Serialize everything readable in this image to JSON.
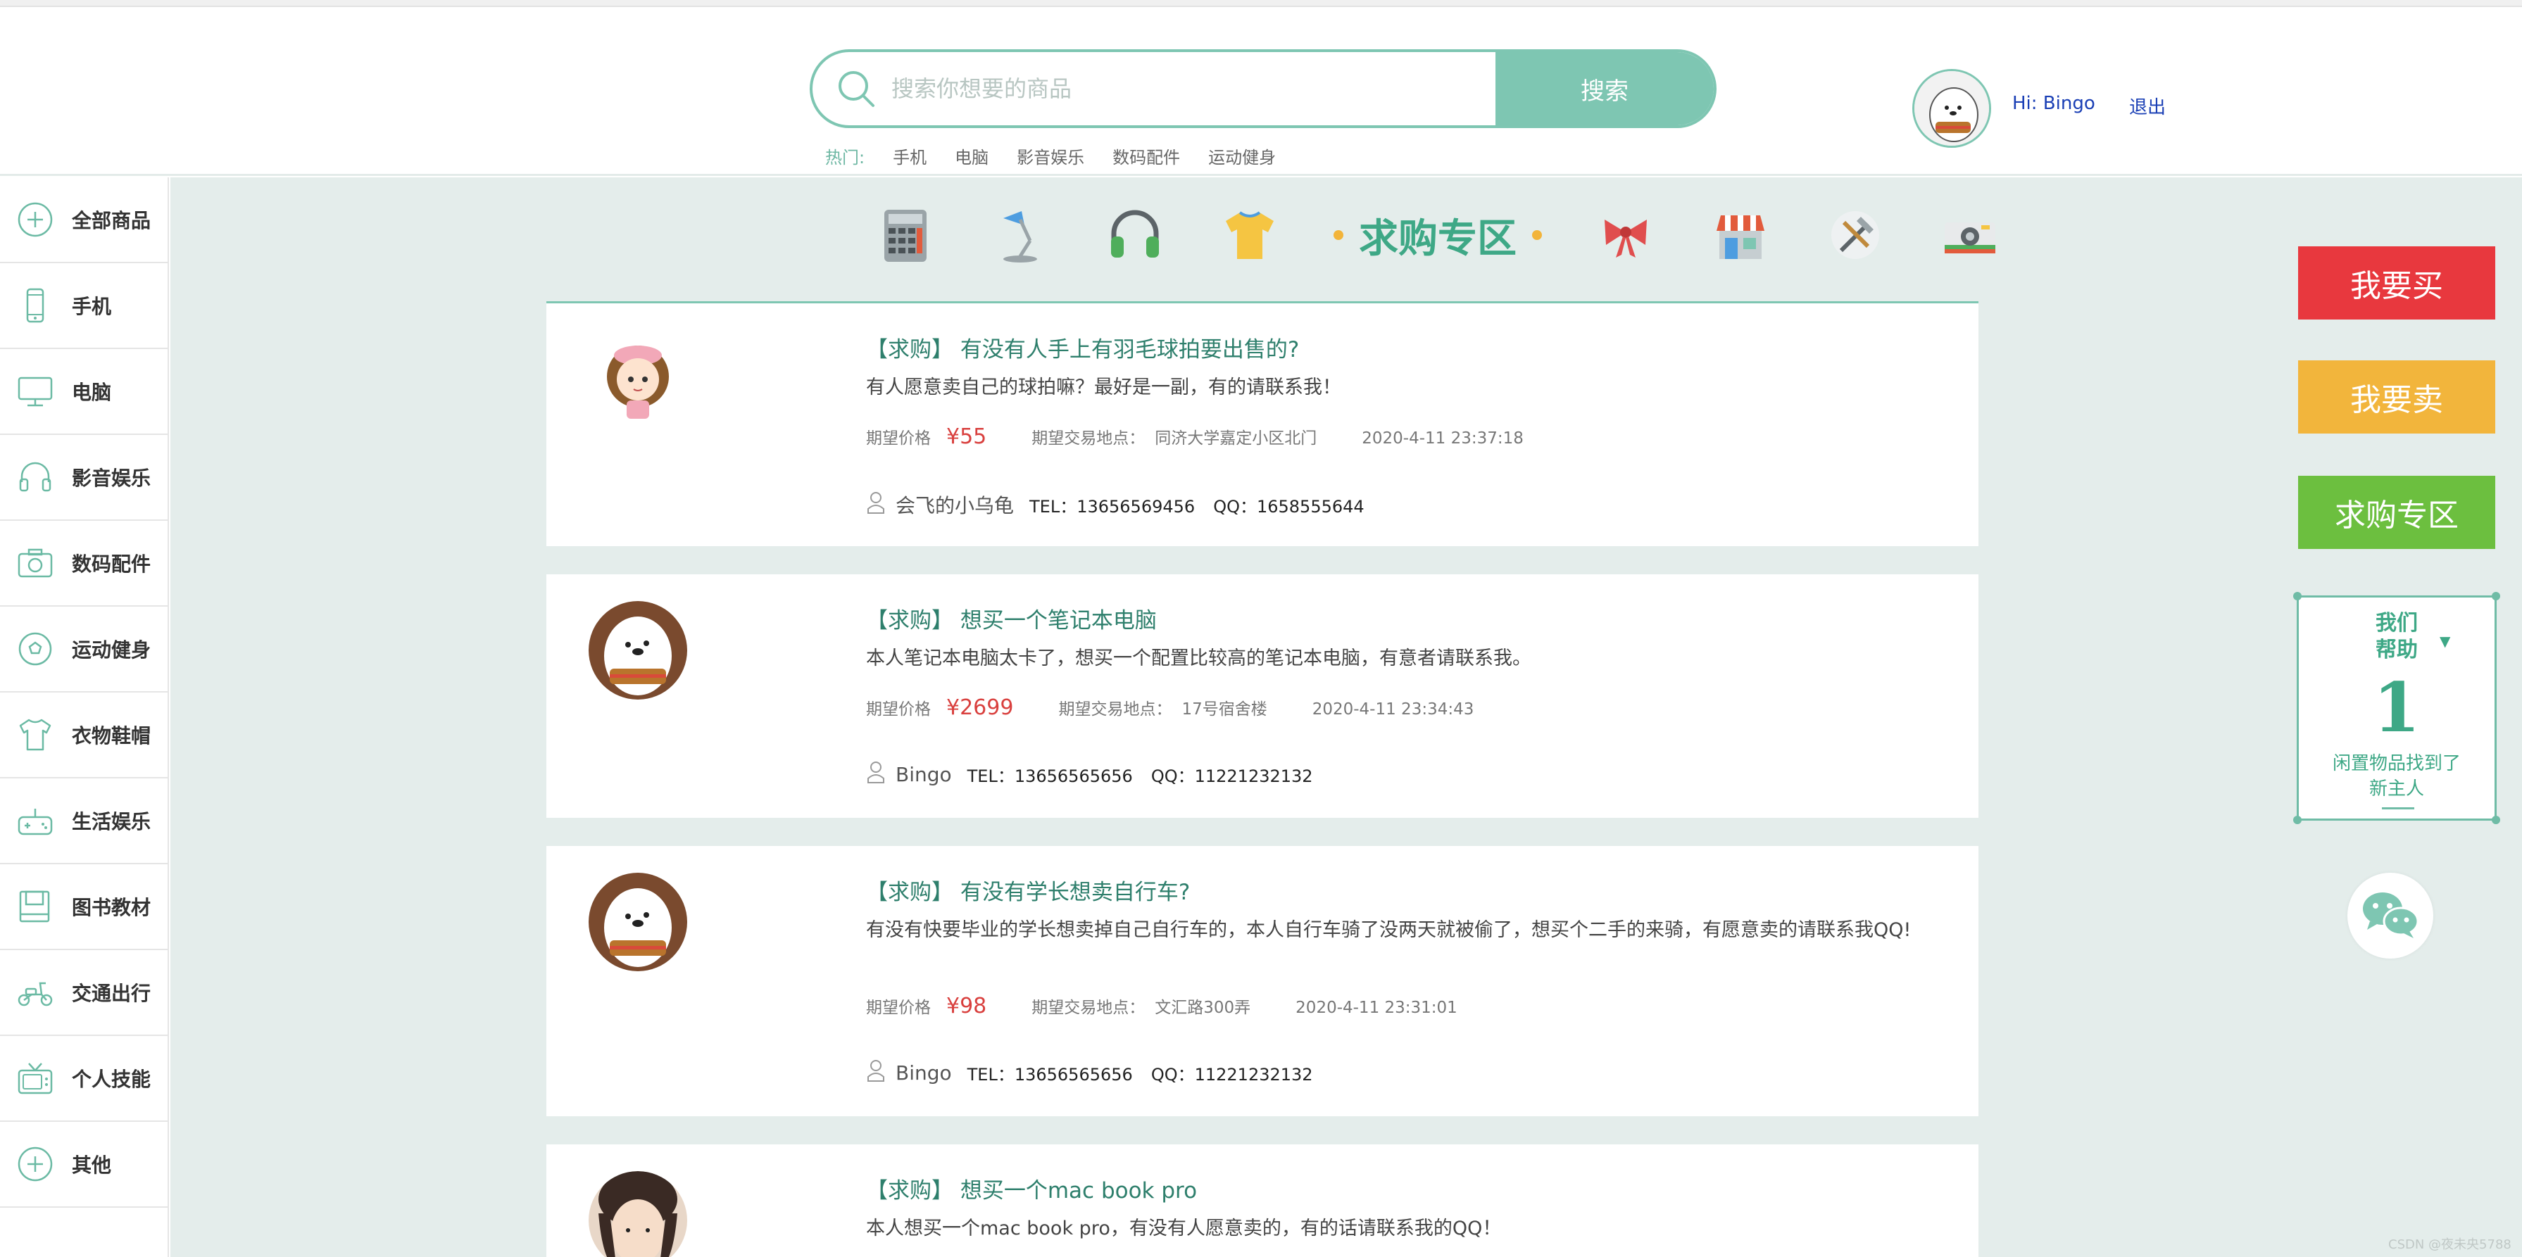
{
  "header": {
    "search_placeholder": "搜索你想要的商品",
    "search_button": "搜索",
    "hot_label": "热门:",
    "hot_links": [
      "手机",
      "电脑",
      "影音娱乐",
      "数码配件",
      "运动健身"
    ],
    "greeting": "Hi:  Bingo",
    "logout": "退出"
  },
  "sidebar": {
    "items": [
      {
        "label": "全部商品",
        "icon": "plus-circle-icon"
      },
      {
        "label": "手机",
        "icon": "phone-icon"
      },
      {
        "label": "电脑",
        "icon": "monitor-icon"
      },
      {
        "label": "影音娱乐",
        "icon": "headphones-icon"
      },
      {
        "label": "数码配件",
        "icon": "camera-icon"
      },
      {
        "label": "运动健身",
        "icon": "ball-icon"
      },
      {
        "label": "衣物鞋帽",
        "icon": "shirt-icon"
      },
      {
        "label": "生活娱乐",
        "icon": "gamepad-icon"
      },
      {
        "label": "图书教材",
        "icon": "book-icon"
      },
      {
        "label": "交通出行",
        "icon": "scooter-icon"
      },
      {
        "label": "个人技能",
        "icon": "tv-icon"
      },
      {
        "label": "其他",
        "icon": "plus-circle-icon"
      }
    ]
  },
  "banner": {
    "title": "求购专区",
    "icons": [
      "calculator-icon",
      "desk-lamp-icon",
      "headphones-icon",
      "tshirt-icon",
      "bow-icon",
      "shop-icon",
      "tools-icon",
      "camera-icon"
    ]
  },
  "posts": [
    {
      "tag": "【求购】",
      "title": "有没有人手上有羽毛球拍要出售的?",
      "desc": "有人愿意卖自己的球拍嘛？最好是一副，有的请联系我！",
      "price_label": "期望价格",
      "price": "¥55",
      "location_label": "期望交易地点：",
      "location": "同济大学嘉定小区北门",
      "time": "2020-4-11 23:37:18",
      "user": "会飞的小乌龟",
      "tel": "TEL：13656569456",
      "qq": "QQ：1658555644"
    },
    {
      "tag": "【求购】",
      "title": "想买一个笔记本电脑",
      "desc": "本人笔记本电脑太卡了，想买一个配置比较高的笔记本电脑，有意者请联系我。",
      "price_label": "期望价格",
      "price": "¥2699",
      "location_label": "期望交易地点：",
      "location": "17号宿舍楼",
      "time": "2020-4-11 23:34:43",
      "user": "Bingo",
      "tel": "TEL：13656565656",
      "qq": "QQ：11221232132"
    },
    {
      "tag": "【求购】",
      "title": "有没有学长想卖自行车?",
      "desc": "有没有快要毕业的学长想卖掉自己自行车的，本人自行车骑了没两天就被偷了，想买个二手的来骑，有愿意卖的请联系我QQ!",
      "price_label": "期望价格",
      "price": "¥98",
      "location_label": "期望交易地点：",
      "location": "文汇路300弄",
      "time": "2020-4-11 23:31:01",
      "user": "Bingo",
      "tel": "TEL：13656565656",
      "qq": "QQ：11221232132"
    },
    {
      "tag": "【求购】",
      "title": "想买一个mac book pro",
      "desc": "本人想买一个mac book pro，有没有人愿意卖的，有的话请联系我的QQ！"
    }
  ],
  "right_panel": {
    "buy": "我要买",
    "sell": "我要卖",
    "want": "求购专区",
    "help_title_1": "我们",
    "help_title_2": "帮助",
    "help_number": "1",
    "help_footer_1": "闲置物品找到了",
    "help_footer_2": "新主人"
  },
  "colors": {
    "accent": "#7ec6b2",
    "buy": "#e8383e",
    "sell": "#f2b53c",
    "want": "#6cbf3f",
    "price": "#d9403e"
  },
  "watermark": "CSDN @夜未央5788"
}
